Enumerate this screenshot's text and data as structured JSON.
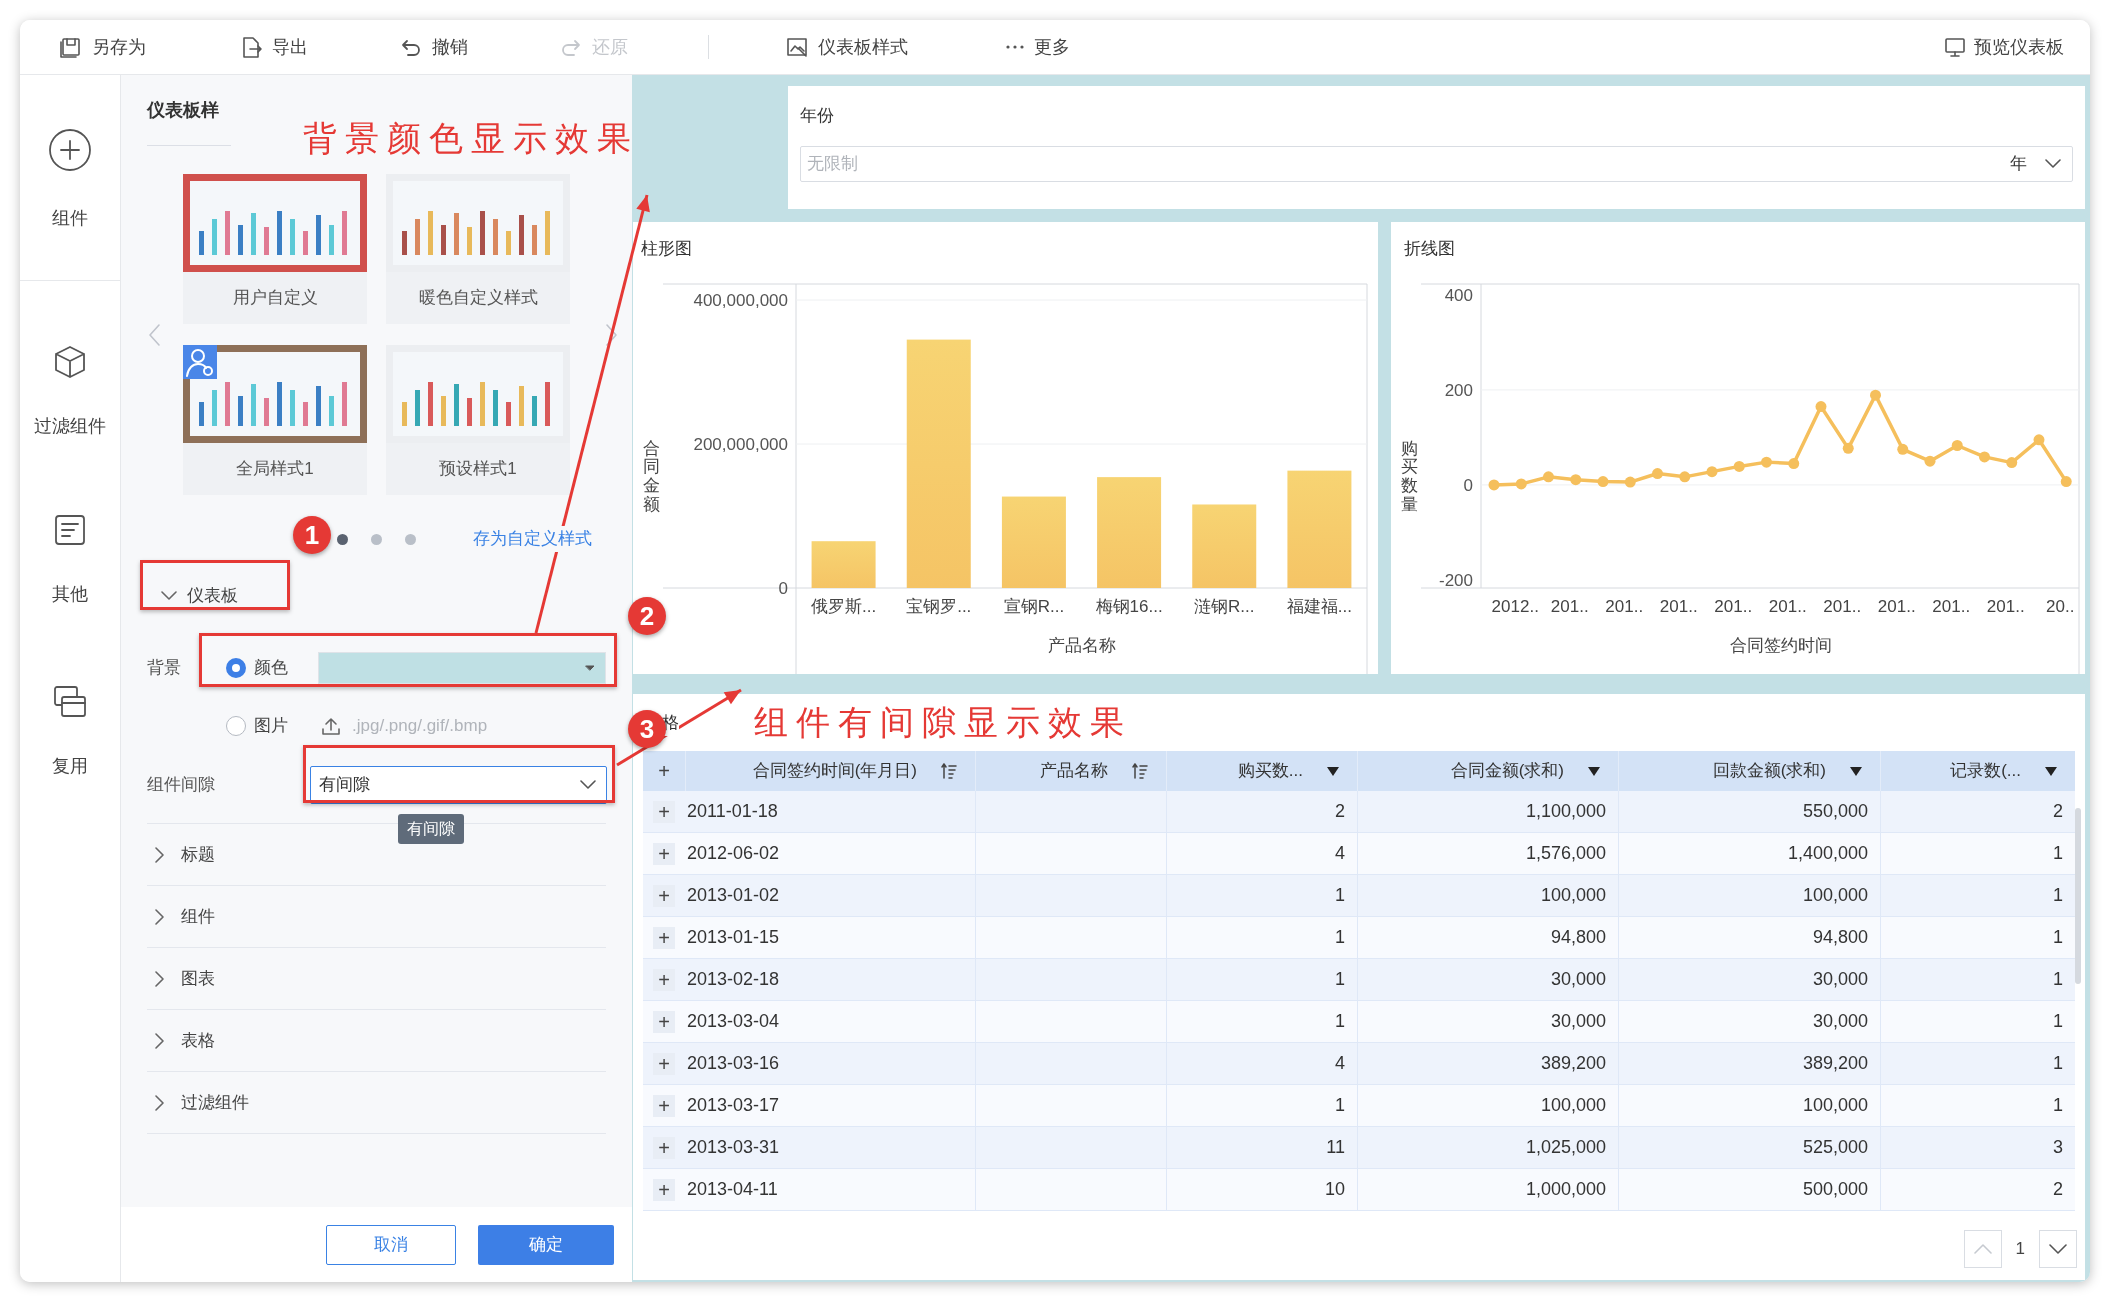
{
  "toolbar": {
    "items": [
      {
        "kind": "save",
        "label": "另存为",
        "disabled": false
      },
      {
        "kind": "export",
        "label": "导出",
        "disabled": false
      },
      {
        "kind": "undo",
        "label": "撤销",
        "disabled": false
      },
      {
        "kind": "redo",
        "label": "还原",
        "disabled": true
      },
      {
        "kind": "style",
        "label": "仪表板样式",
        "disabled": false
      },
      {
        "kind": "more",
        "label": "更多",
        "disabled": false
      }
    ],
    "preview": "预览仪表板"
  },
  "sidebar": [
    {
      "kind": "add",
      "label": "组件"
    },
    {
      "kind": "filter",
      "label": "过滤组件"
    },
    {
      "kind": "other",
      "label": "其他"
    },
    {
      "kind": "reuse",
      "label": "复用"
    }
  ],
  "style_panel": {
    "title": "仪表板样",
    "styles": [
      {
        "kind": "user",
        "label": "用户自定义"
      },
      {
        "kind": "warm",
        "label": "暖色自定义样式"
      },
      {
        "kind": "global",
        "label": "全局样式1"
      },
      {
        "kind": "preset",
        "label": "预设样式1"
      }
    ],
    "pages": [
      {
        "selected": true
      },
      {
        "selected": false
      },
      {
        "selected": false
      }
    ],
    "save_link": "存为自定义样式",
    "sections": [
      {
        "label": "仪表板",
        "expanded": true
      },
      {
        "label": "标题",
        "expanded": false
      },
      {
        "label": "组件",
        "expanded": false
      },
      {
        "label": "图表",
        "expanded": false
      },
      {
        "label": "表格",
        "expanded": false
      },
      {
        "label": "过滤组件",
        "expanded": false
      }
    ],
    "background": {
      "label": "背景",
      "options": [
        {
          "label": "颜色",
          "selected": true
        },
        {
          "label": "图片",
          "selected": false
        }
      ],
      "formats": ".jpg/.png/.gif/.bmp"
    },
    "gap": {
      "label": "组件间隙",
      "value": "有间隙",
      "tooltip": "有间隙"
    },
    "cancel": "取消",
    "ok": "确定"
  },
  "dashboard": {
    "filter": {
      "label": "年份",
      "placeholder": "无限制",
      "unit": "年"
    },
    "bar_chart": {
      "title": "柱形图",
      "chart_data": {
        "type": "bar",
        "xlabel": "产品名称",
        "ylabel": "合同金额",
        "categories": [
          "俄罗斯...",
          "宝钢罗...",
          "宣钢R...",
          "梅钢16...",
          "涟钢R...",
          "福建福..."
        ],
        "series": [
          {
            "color": "#f5c465",
            "values": [
              65000000,
              345000000,
              127000000,
              154000000,
              116000000,
              163000000
            ]
          }
        ],
        "ylim": [
          0,
          400000000
        ],
        "yticks": [
          {
            "value": 0,
            "label": "0"
          },
          {
            "value": 200000000,
            "label": "200,000,000"
          },
          {
            "value": 400000000,
            "label": "400,000,000"
          }
        ]
      }
    },
    "line_chart": {
      "title": "折线图",
      "chart_data": {
        "type": "line",
        "xlabel": "合同签约时间",
        "ylabel": "购买数量",
        "categories": [
          null,
          "2012..",
          null,
          "201..",
          null,
          "201..",
          null,
          "201..",
          null,
          "201..",
          null,
          "201..",
          null,
          "201..",
          null,
          "201..",
          null,
          "201..",
          null,
          "201..",
          null,
          "20.."
        ],
        "series": [
          {
            "color": "#f5bf5c",
            "marker": "circle",
            "values": [
              0,
              2,
              17,
              11,
              7,
              6,
              24,
              17,
              28,
              39,
              48,
              45,
              165,
              77,
              189,
              75,
              50,
              83,
              59,
              47,
              95,
              7
            ]
          }
        ],
        "ylim": [
          -217,
          423
        ],
        "yticks": [
          -200,
          0,
          200,
          400
        ]
      }
    },
    "table": {
      "title": "格",
      "columns": [
        {
          "kind": "expand",
          "label": "+"
        },
        {
          "kind": "sort",
          "label": "合同签约时间(年月日)"
        },
        {
          "kind": "sort",
          "label": "产品名称"
        },
        {
          "kind": "menu",
          "label": "购买数..."
        },
        {
          "kind": "menu",
          "label": "合同金额(求和)"
        },
        {
          "kind": "menu",
          "label": "回款金额(求和)"
        },
        {
          "kind": "menu",
          "label": "记录数(..."
        }
      ],
      "rows": [
        {
          "expander": "+",
          "date": "2011-01-18",
          "qty": "2",
          "amount": "1,100,000",
          "refund": "550,000",
          "count": "2"
        },
        {
          "expander": "+",
          "date": "2012-06-02",
          "qty": "4",
          "amount": "1,576,000",
          "refund": "1,400,000",
          "count": "1"
        },
        {
          "expander": "+",
          "date": "2013-01-02",
          "qty": "1",
          "amount": "100,000",
          "refund": "100,000",
          "count": "1"
        },
        {
          "expander": "+",
          "date": "2013-01-15",
          "qty": "1",
          "amount": "94,800",
          "refund": "94,800",
          "count": "1"
        },
        {
          "expander": "+",
          "date": "2013-02-18",
          "qty": "1",
          "amount": "30,000",
          "refund": "30,000",
          "count": "1"
        },
        {
          "expander": "+",
          "date": "2013-03-04",
          "qty": "1",
          "amount": "30,000",
          "refund": "30,000",
          "count": "1"
        },
        {
          "expander": "+",
          "date": "2013-03-16",
          "qty": "4",
          "amount": "389,200",
          "refund": "389,200",
          "count": "1"
        },
        {
          "expander": "+",
          "date": "2013-03-17",
          "qty": "1",
          "amount": "100,000",
          "refund": "100,000",
          "count": "1"
        },
        {
          "expander": "+",
          "date": "2013-03-31",
          "qty": "11",
          "amount": "1,025,000",
          "refund": "525,000",
          "count": "3"
        },
        {
          "expander": "+",
          "date": "2013-04-11",
          "qty": "10",
          "amount": "1,000,000",
          "refund": "500,000",
          "count": "2"
        }
      ],
      "page": "1"
    }
  },
  "annotations": {
    "captions": [
      "背景颜色显示效果",
      "组件有间隙显示效果"
    ],
    "markers": [
      "1",
      "2",
      "3"
    ]
  }
}
